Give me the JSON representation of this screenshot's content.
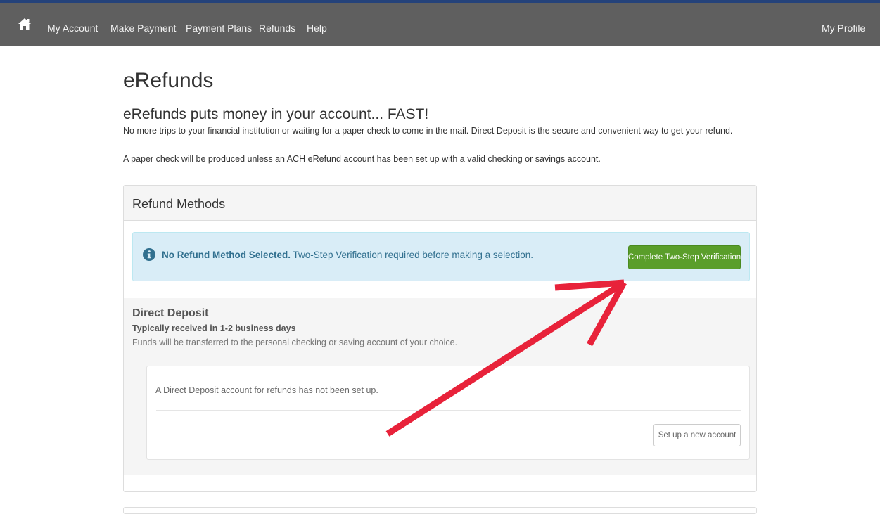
{
  "nav": {
    "home_icon": "home-icon",
    "items": [
      {
        "label": "My Account"
      },
      {
        "label": "Make Payment"
      },
      {
        "label": "Payment Plans"
      },
      {
        "label": "Refunds"
      },
      {
        "label": "Help"
      }
    ],
    "profile_label": "My Profile"
  },
  "page": {
    "title": "eRefunds",
    "subtitle": "eRefunds puts money in your account... FAST!",
    "paragraph1": "No more trips to your financial institution or waiting for a paper check to come in the mail. Direct Deposit is the secure and convenient way to get your refund.",
    "paragraph2": "A paper check will be produced unless an ACH eRefund account has been set up with a valid checking or savings account."
  },
  "panel": {
    "title": "Refund Methods",
    "alert": {
      "icon": "info-icon",
      "bold_text": "No Refund Method Selected.",
      "text": " Two-Step Verification required before making a selection.",
      "button_label": "Complete Two-Step Verification"
    },
    "direct_deposit": {
      "title": "Direct Deposit",
      "subtitle": "Typically received in 1-2 business days",
      "description": "Funds will be transferred to the personal checking or saving account of your choice.",
      "message": "A Direct Deposit account for refunds has not been set up.",
      "button_label": "Set up a new account"
    }
  },
  "colors": {
    "navbar": "#5f5f5f",
    "topline": "#24427a",
    "alert_bg": "#d9edf7",
    "alert_text": "#31708f",
    "success_button": "#5a9e2a",
    "annotation_arrow": "#e8223a"
  }
}
